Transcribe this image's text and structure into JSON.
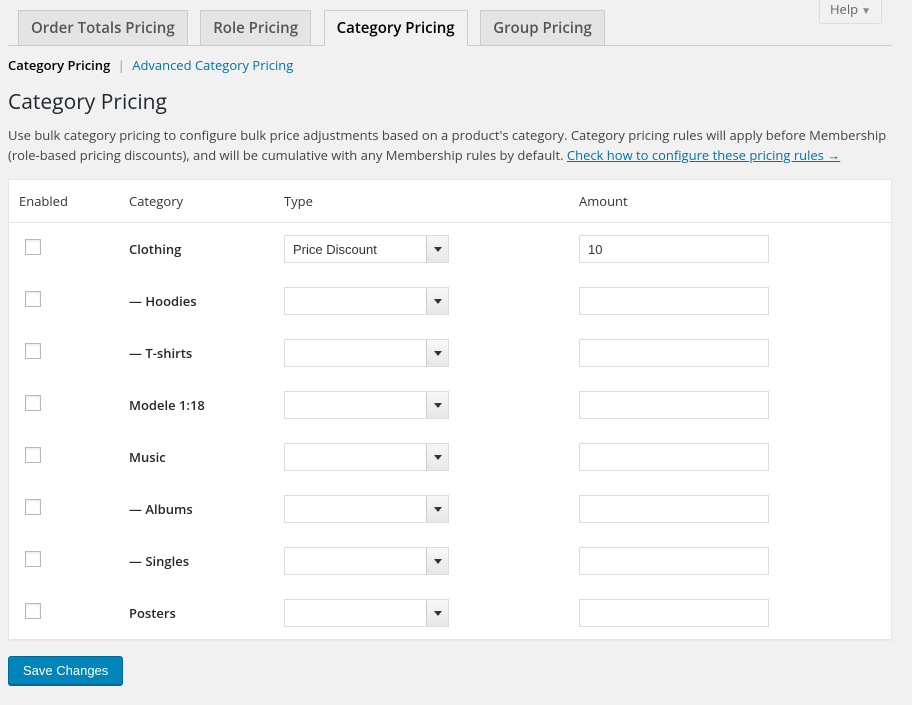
{
  "help": {
    "label": "Help"
  },
  "tabs": [
    {
      "label": "Order Totals Pricing",
      "active": false
    },
    {
      "label": "Role Pricing",
      "active": false
    },
    {
      "label": "Category Pricing",
      "active": true
    },
    {
      "label": "Group Pricing",
      "active": false
    }
  ],
  "subtabs": {
    "current": "Category Pricing",
    "other": "Advanced Category Pricing"
  },
  "section": {
    "title": "Category Pricing",
    "description": "Use bulk category pricing to configure bulk price adjustments based on a product's category. Category pricing rules will apply before Membership (role-based pricing discounts), and will be cumulative with any Membership rules by default. ",
    "help_link": "Check how to configure these pricing rules →"
  },
  "table": {
    "headers": {
      "enabled": "Enabled",
      "category": "Category",
      "type": "Type",
      "amount": "Amount"
    },
    "rows": [
      {
        "enabled": false,
        "category": "Clothing",
        "type": "Price Discount",
        "amount": "10"
      },
      {
        "enabled": false,
        "category": "— Hoodies",
        "type": "",
        "amount": ""
      },
      {
        "enabled": false,
        "category": "— T-shirts",
        "type": "",
        "amount": ""
      },
      {
        "enabled": false,
        "category": "Modele 1:18",
        "type": "",
        "amount": ""
      },
      {
        "enabled": false,
        "category": "Music",
        "type": "",
        "amount": ""
      },
      {
        "enabled": false,
        "category": "— Albums",
        "type": "",
        "amount": ""
      },
      {
        "enabled": false,
        "category": "— Singles",
        "type": "",
        "amount": ""
      },
      {
        "enabled": false,
        "category": "Posters",
        "type": "",
        "amount": ""
      }
    ]
  },
  "actions": {
    "save": "Save Changes"
  }
}
